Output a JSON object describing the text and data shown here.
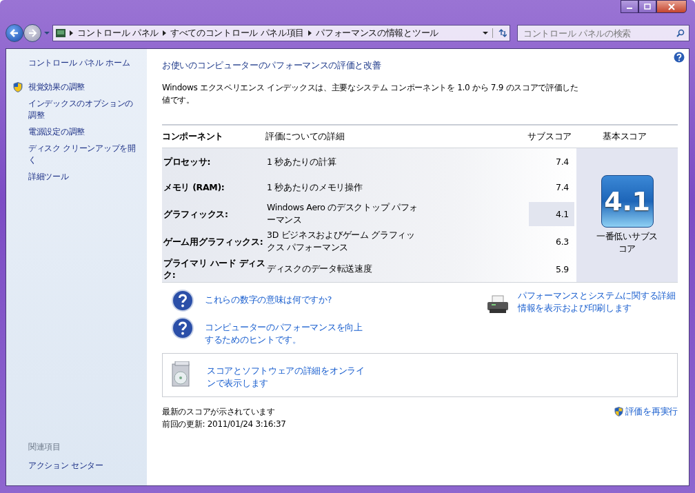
{
  "address_bar": {
    "crumbs": [
      "コントロール パネル",
      "すべてのコントロール パネル項目",
      "パフォーマンスの情報とツール"
    ]
  },
  "search": {
    "placeholder": "コントロール パネルの検索"
  },
  "sidebar": {
    "items": [
      {
        "label": "コントロール パネル ホーム",
        "kind": "home"
      },
      {
        "label": "視覚効果の調整",
        "kind": "shield"
      },
      {
        "label": "インデックスのオプションの調整",
        "kind": "plain"
      },
      {
        "label": "電源設定の調整",
        "kind": "plain"
      },
      {
        "label": "ディスク クリーンアップを開く",
        "kind": "plain"
      },
      {
        "label": "詳細ツール",
        "kind": "plain"
      }
    ],
    "see_also": {
      "heading": "関連項目",
      "items": [
        "アクション センター"
      ]
    }
  },
  "main": {
    "title": "お使いのコンピューターのパフォーマンスの評価と改善",
    "intro": "Windows エクスペリエンス インデックスは、主要なシステム コンポーネントを 1.0 から 7.9 のスコアで評価した値です。",
    "table": {
      "columns": [
        "コンポーネント",
        "評価についての詳細",
        "サブスコア",
        "基本スコア"
      ],
      "rows": [
        {
          "component": "プロセッサ:",
          "detail": "1 秒あたりの計算",
          "subscore": "7.4",
          "lowest": false
        },
        {
          "component": "メモリ (RAM):",
          "detail": "1 秒あたりのメモリ操作",
          "subscore": "7.4",
          "lowest": false
        },
        {
          "component": "グラフィックス:",
          "detail": "Windows Aero のデスクトップ パフォーマンス",
          "subscore": "4.1",
          "lowest": true
        },
        {
          "component": "ゲーム用グラフィックス:",
          "detail": "3D ビジネスおよびゲーム グラフィックス パフォーマンス",
          "subscore": "6.3",
          "lowest": false
        },
        {
          "component": "プライマリ ハード ディスク:",
          "detail": "ディスクのデータ転送速度",
          "subscore": "5.9",
          "lowest": false
        }
      ],
      "base_score": {
        "value": "4.1",
        "caption": "一番低いサブスコア"
      }
    },
    "help_links": [
      "これらの数字の意味は何ですか?",
      "コンピューターのパフォーマンスを向上するためのヒントです。"
    ],
    "print_link": "パフォーマンスとシステムに関する詳細情報を表示および印刷します",
    "online_link": "スコアとソフトウェアの詳細をオンラインで表示します",
    "status": "最新のスコアが示されています",
    "last_update": "前回の更新: 2011/01/24 3:16:37",
    "rerun": "評価を再実行"
  }
}
